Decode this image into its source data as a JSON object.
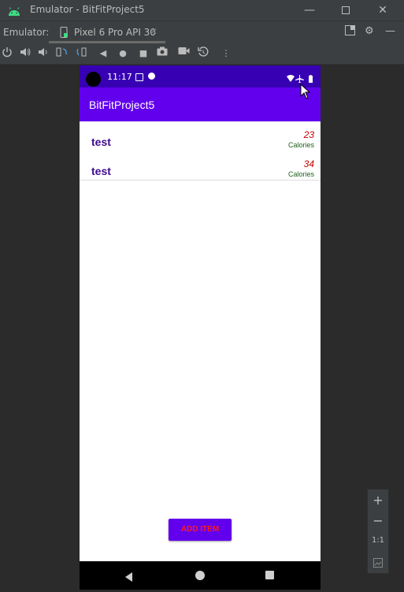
{
  "window": {
    "title": "Emulator - BitFitProject5"
  },
  "tabbar": {
    "label": "Emulator:",
    "tab_label": "Pixel 6 Pro API 30"
  },
  "phone": {
    "time": "11:17",
    "app_title": "BitFitProject5",
    "items": [
      {
        "name": "test",
        "calories": "23",
        "unit": "Calories"
      },
      {
        "name": "test",
        "calories": "34",
        "unit": "Calories"
      }
    ],
    "add_button": "ADD ITEM"
  },
  "zoom": {
    "plus": "+",
    "minus": "−",
    "one_to_one": "1:1"
  },
  "colors": {
    "status_bar": "#3700b3",
    "app_bar": "#6200ee",
    "accent_text": "#ff1a1a",
    "item_name": "#3d0a91"
  }
}
